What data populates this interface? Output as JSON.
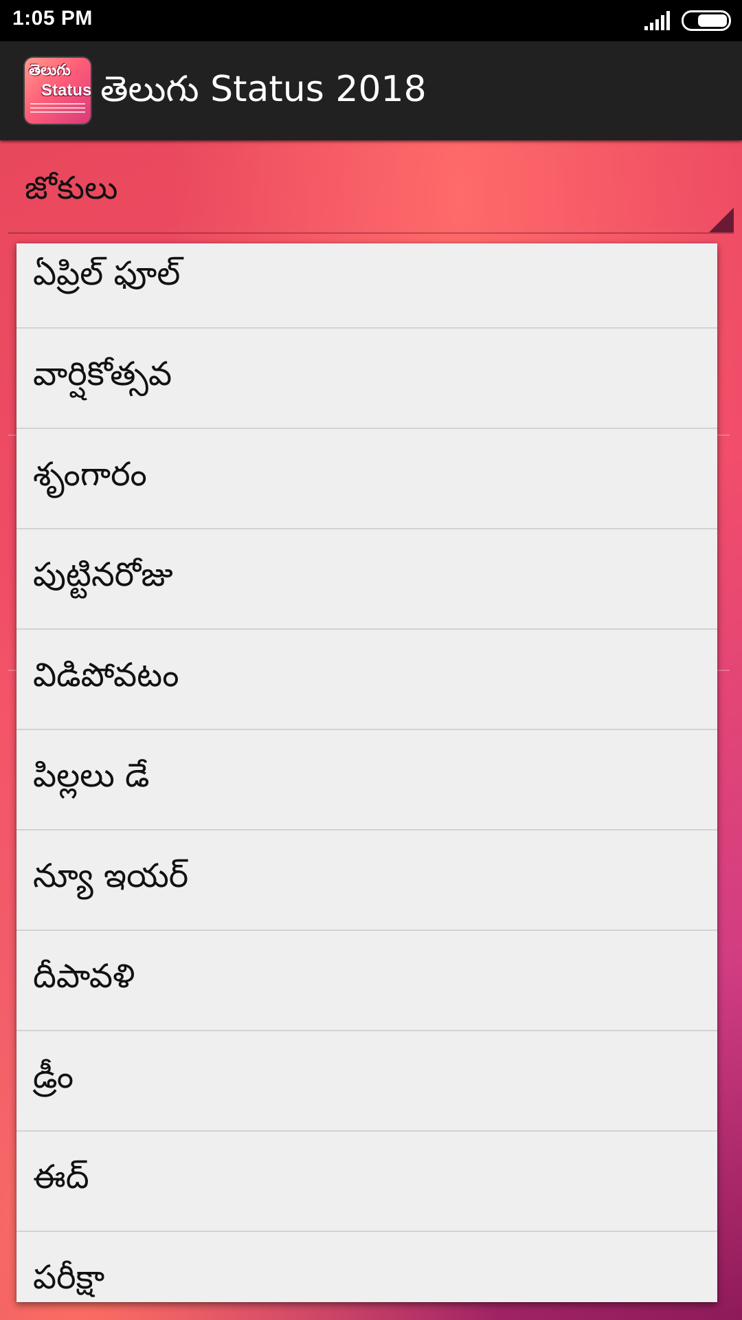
{
  "status_bar": {
    "time": "1:05 PM",
    "icons": [
      "signal-icon",
      "battery-icon"
    ]
  },
  "app_bar": {
    "logo": {
      "line1": "తెలుగు",
      "line2": "Status"
    },
    "title": "తెలుగు Status 2018"
  },
  "spinner": {
    "selected": "జోకులు"
  },
  "dropdown": {
    "items": [
      "ఏప్రిల్ ఫూల్",
      "వార్షికోత్సవ",
      "శృంగారం",
      "పుట్టినరోజు",
      "విడిపోవటం",
      "పిల్లలు డే",
      "న్యూ ఇయర్",
      "దీపావళి",
      "డ్రీం",
      "ఈద్",
      "పరీక్షా"
    ]
  },
  "colors": {
    "app_bar": "#212121",
    "dropdown_bg": "#efefef",
    "accent_pink": "#f24d6a"
  }
}
